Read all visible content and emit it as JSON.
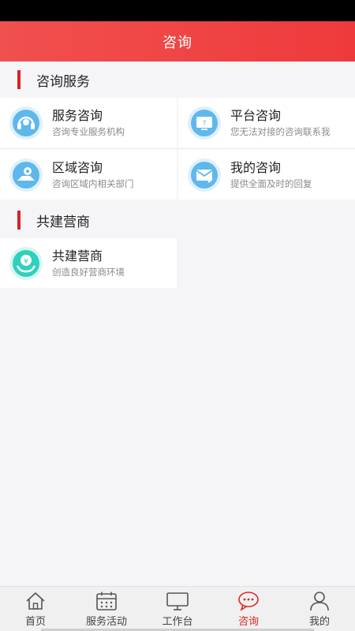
{
  "header": {
    "title": "咨询"
  },
  "sections": [
    {
      "title": "咨询服务"
    },
    {
      "title": "共建营商"
    }
  ],
  "cards": [
    {
      "title": "服务咨询",
      "subtitle": "咨询专业服务机构",
      "icon": "headset-icon"
    },
    {
      "title": "平台咨询",
      "subtitle": "您无法对接的咨询联系我",
      "icon": "monitor-question-icon"
    },
    {
      "title": "区域咨询",
      "subtitle": "咨询区域内相关部门",
      "icon": "map-location-icon"
    },
    {
      "title": "我的咨询",
      "subtitle": "提供全面及时的回复",
      "icon": "mail-reply-icon"
    },
    {
      "title": "共建营商",
      "subtitle": "创造良好营商环境",
      "icon": "yen-hands-icon"
    }
  ],
  "tabs": [
    {
      "label": "首页",
      "icon": "home-icon"
    },
    {
      "label": "服务活动",
      "icon": "calendar-icon"
    },
    {
      "label": "工作台",
      "icon": "desktop-icon"
    },
    {
      "label": "咨询",
      "icon": "chat-bubble-icon",
      "active": true
    },
    {
      "label": "我的",
      "icon": "user-icon"
    }
  ],
  "colors": {
    "accent": "#e0272a",
    "header": "#ef4444",
    "icon_blue": "#3aa3e3",
    "icon_teal": "#26c6b4"
  }
}
